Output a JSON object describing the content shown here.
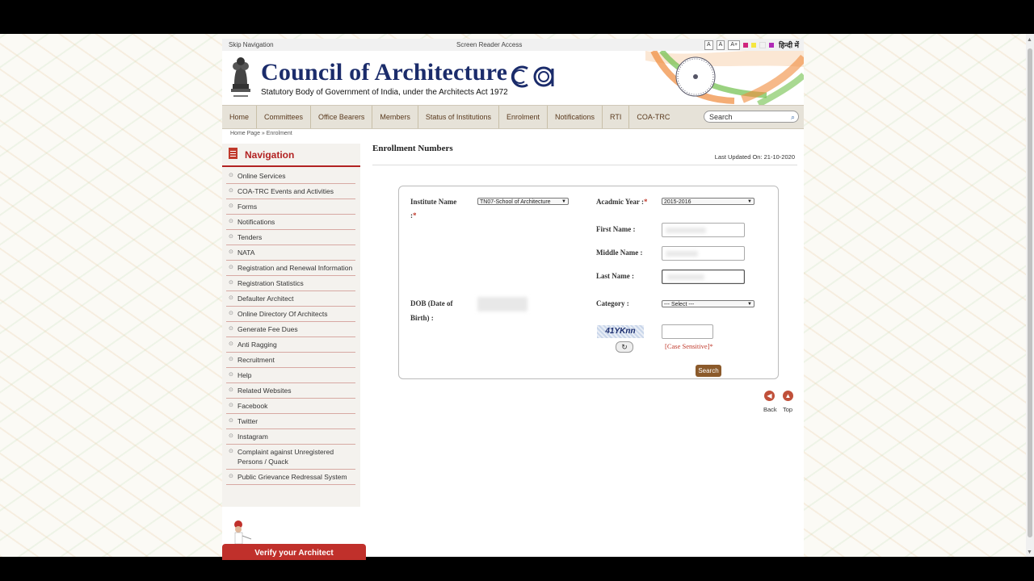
{
  "utility": {
    "skip": "Skip Navigation",
    "reader": "Screen Reader Access",
    "font_buttons": [
      "A",
      "A",
      "A+"
    ],
    "lang": "हिन्दी में"
  },
  "header": {
    "title": "Council of Architecture",
    "subtitle": "Statutory Body of Government of India, under the Architects Act 1972",
    "logo_text": "ca"
  },
  "nav": {
    "items": [
      "Home",
      "Committees",
      "Office Bearers",
      "Members",
      "Status of Institutions",
      "Enrolment",
      "Notifications",
      "RTI",
      "COA-TRC"
    ],
    "search_placeholder": "Search"
  },
  "breadcrumb": "Home Page »  Enrolment",
  "sidebar": {
    "title": "Navigation",
    "items": [
      "Online Services",
      "COA-TRC Events and Activities",
      "Forms",
      "Notifications",
      "Tenders",
      "NATA",
      "Registration and Renewal Information",
      "Registration Statistics",
      "Defaulter Architect",
      "Online Directory Of Architects",
      "Generate Fee Dues",
      "Anti Ragging",
      "Recruitment",
      "Help",
      "Related Websites",
      "Facebook",
      "Twitter",
      "Instagram",
      "Complaint against Unregistered Persons / Quack",
      "Public Grievance Redressal System"
    ],
    "verify_label": "Verify your Architect"
  },
  "content": {
    "title": "Enrollment Numbers",
    "last_updated": "Last Updated On: 21-10-2020"
  },
  "form": {
    "institute_label": "Institute Name",
    "institute_suffix": ":",
    "institute_value": "TN07-School of Architecture",
    "year_label": "Acadmic Year :",
    "year_value": "2015-2016",
    "first_name_label": "First Name :",
    "middle_name_label": "Middle Name :",
    "last_name_label": "Last Name :",
    "dob_label_line1": "DOB (Date of",
    "dob_label_line2": "Birth) :",
    "category_label": "Category :",
    "category_value": "--- Select ---",
    "captcha_text": "41YKnn",
    "case_sensitive": "[Case Sensitive]*",
    "search_button": "Search"
  },
  "footer_nav": {
    "back": "Back",
    "top": "Top"
  }
}
